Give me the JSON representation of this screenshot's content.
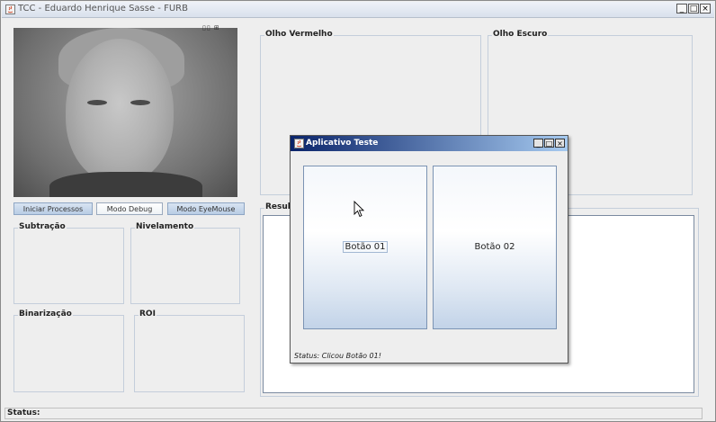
{
  "window": {
    "title": "TCC - Eduardo Henrique Sasse - FURB",
    "min": "_",
    "max": "□",
    "close": "×"
  },
  "webcam": {
    "controls": "▯▯ ⊞"
  },
  "buttons": {
    "start": "Iniciar Processos",
    "debug": "Modo Debug",
    "eyemouse": "Modo EyeMouse"
  },
  "panels": {
    "olho_vermelho": "Olho Vermelho",
    "olho_escuro": "Olho Escuro",
    "resultado": "Resulta",
    "subtracao": "Subtração",
    "nivelamento": "Nivelamento",
    "binarizacao": "Binarização",
    "roi": "ROI"
  },
  "status": {
    "label": "Status:"
  },
  "dialog": {
    "title": "Aplicativo Teste",
    "min": "_",
    "max": "□",
    "close": "×",
    "button1": "Botão 01",
    "button2": "Botão 02",
    "status": "Status: Clicou Botão 01!"
  }
}
